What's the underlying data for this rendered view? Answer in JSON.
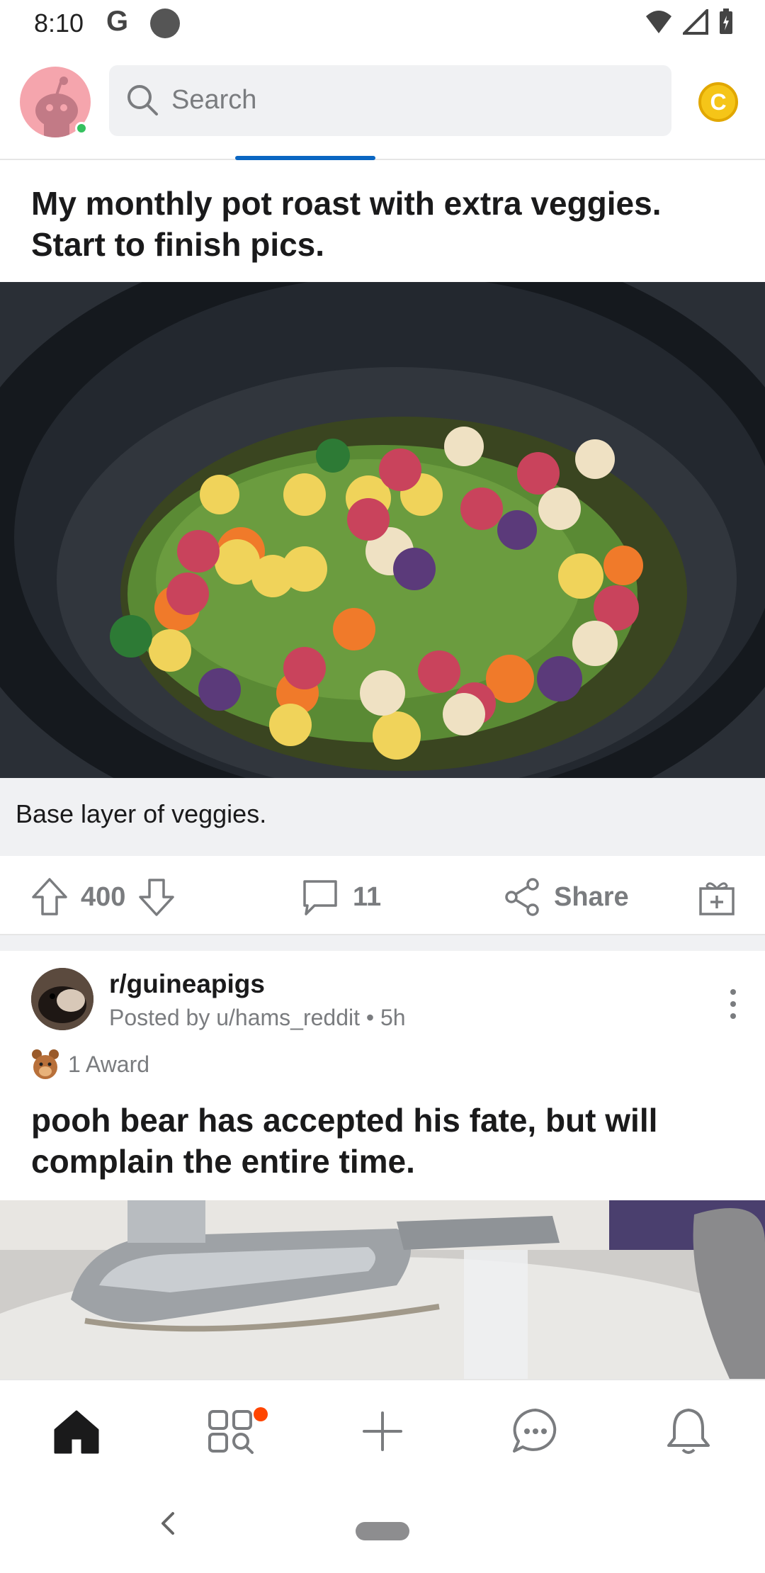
{
  "status_bar": {
    "time": "8:10",
    "google_letter": "G"
  },
  "header": {
    "search_placeholder": "Search",
    "coin_letter": "C"
  },
  "post1": {
    "title": "My monthly pot roast with extra veggies. Start to finish pics.",
    "image_caption": "Base layer of veggies.",
    "upvotes": "400",
    "comments": "11",
    "share_label": "Share"
  },
  "post2": {
    "subreddit": "r/guineapigs",
    "meta": "Posted by u/hams_reddit • 5h",
    "award_label": "1 Award",
    "title": "pooh bear has accepted his fate, but will complain the entire time."
  },
  "bottom_nav": {
    "items": [
      "home",
      "communities",
      "create",
      "chat",
      "notifications"
    ]
  },
  "colors": {
    "accent": "#0a66c2",
    "notification_dot": "#ff4500",
    "coin": "#f5c518",
    "online": "#35c15f"
  }
}
